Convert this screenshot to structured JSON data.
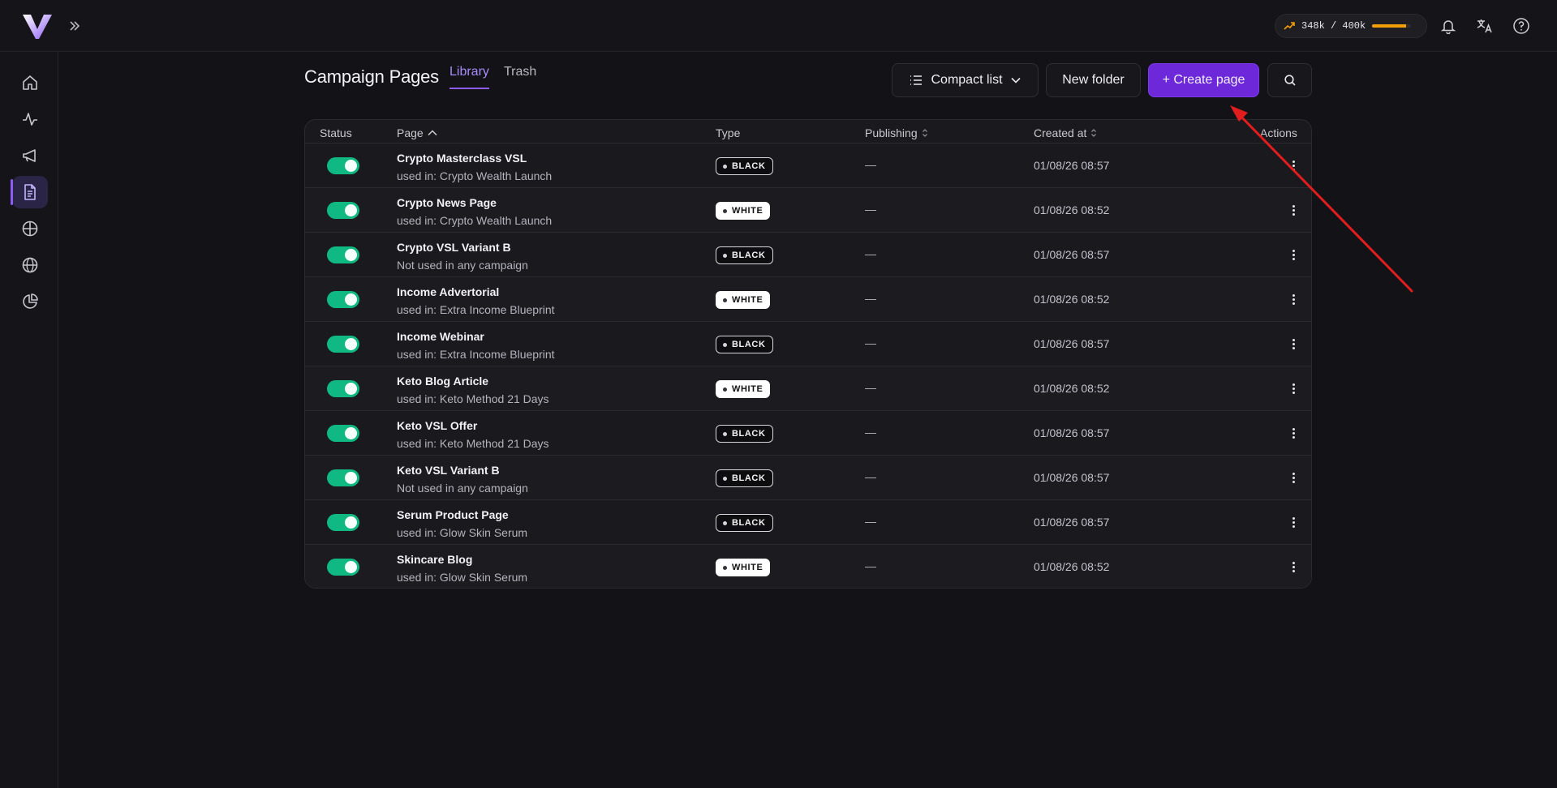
{
  "topbar": {
    "usage_text": "348k / 400k",
    "usage_fraction": 0.87,
    "accent": "#f59e0b"
  },
  "sidebar": {
    "items": [
      {
        "icon": "home-icon"
      },
      {
        "icon": "activity-icon"
      },
      {
        "icon": "megaphone-icon"
      },
      {
        "icon": "document-icon",
        "active": true
      },
      {
        "icon": "crosshair-icon"
      },
      {
        "icon": "globe-icon"
      },
      {
        "icon": "pie-chart-icon"
      }
    ]
  },
  "header": {
    "title": "Campaign Pages",
    "tabs": [
      {
        "label": "Library",
        "active": true
      },
      {
        "label": "Trash",
        "active": false
      }
    ]
  },
  "toolbar": {
    "view_label": "Compact list",
    "new_folder_label": "New folder",
    "create_label": "+ Create page"
  },
  "table": {
    "columns": {
      "status": "Status",
      "page": "Page",
      "type": "Type",
      "publishing": "Publishing",
      "created": "Created at",
      "actions": "Actions"
    },
    "rows": [
      {
        "name": "Crypto Masterclass VSL",
        "sub": "used in: Crypto Wealth Launch",
        "type": "BLACK",
        "publishing": "—",
        "created": "01/08/26 08:57"
      },
      {
        "name": "Crypto News Page",
        "sub": "used in: Crypto Wealth Launch",
        "type": "WHITE",
        "publishing": "—",
        "created": "01/08/26 08:52"
      },
      {
        "name": "Crypto VSL Variant B",
        "sub": "Not used in any campaign",
        "type": "BLACK",
        "publishing": "—",
        "created": "01/08/26 08:57"
      },
      {
        "name": "Income Advertorial",
        "sub": "used in: Extra Income Blueprint",
        "type": "WHITE",
        "publishing": "—",
        "created": "01/08/26 08:52"
      },
      {
        "name": "Income Webinar",
        "sub": "used in: Extra Income Blueprint",
        "type": "BLACK",
        "publishing": "—",
        "created": "01/08/26 08:57"
      },
      {
        "name": "Keto Blog Article",
        "sub": "used in: Keto Method 21 Days",
        "type": "WHITE",
        "publishing": "—",
        "created": "01/08/26 08:52"
      },
      {
        "name": "Keto VSL Offer",
        "sub": "used in: Keto Method 21 Days",
        "type": "BLACK",
        "publishing": "—",
        "created": "01/08/26 08:57"
      },
      {
        "name": "Keto VSL Variant B",
        "sub": "Not used in any campaign",
        "type": "BLACK",
        "publishing": "—",
        "created": "01/08/26 08:57"
      },
      {
        "name": "Serum Product Page",
        "sub": "used in: Glow Skin Serum",
        "type": "BLACK",
        "publishing": "—",
        "created": "01/08/26 08:57"
      },
      {
        "name": "Skincare Blog",
        "sub": "used in: Glow Skin Serum",
        "type": "WHITE",
        "publishing": "—",
        "created": "01/08/26 08:52"
      }
    ]
  },
  "colors": {
    "primary": "#6d28d9",
    "toggle_on": "#10b981",
    "annotation": "#e11d1d"
  }
}
